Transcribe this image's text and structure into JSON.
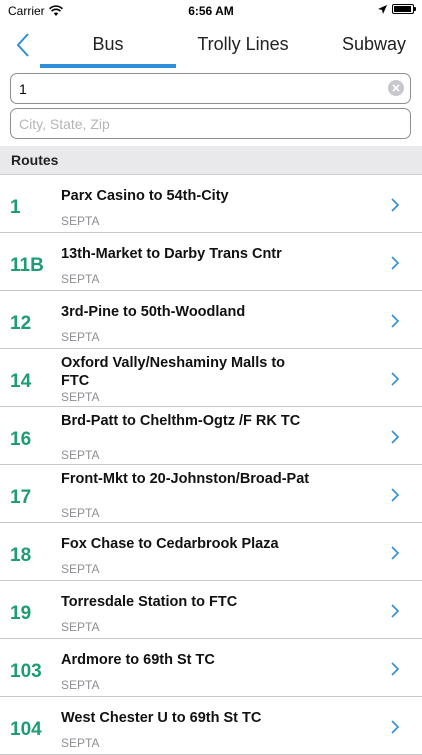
{
  "status_bar": {
    "carrier": "Carrier",
    "time": "6:56 AM",
    "battery_level": 0.95
  },
  "tabs": [
    {
      "label": "Bus",
      "selected": true
    },
    {
      "label": "Trolly Lines",
      "selected": false
    },
    {
      "label": "Subway",
      "selected": false
    }
  ],
  "search": {
    "value": "1",
    "placeholder": ""
  },
  "location": {
    "value": "",
    "placeholder": "City, State, Zip"
  },
  "section": {
    "title": "Routes"
  },
  "colors": {
    "accent": "#2f8fd8",
    "route_number": "#1e9c74"
  },
  "routes": [
    {
      "number": "1",
      "name": "Parx Casino to 54th-City",
      "agency": "SEPTA"
    },
    {
      "number": "11B",
      "name": "13th-Market to Darby Trans Cntr",
      "agency": "SEPTA"
    },
    {
      "number": "12",
      "name": "3rd-Pine to 50th-Woodland",
      "agency": "SEPTA"
    },
    {
      "number": "14",
      "name": "Oxford Vally/Neshaminy Malls to FTC",
      "agency": "SEPTA"
    },
    {
      "number": "16",
      "name": "Brd-Patt to Chelthm-Ogtz /F RK TC",
      "agency": "SEPTA"
    },
    {
      "number": "17",
      "name": "Front-Mkt to 20-Johnston/Broad-Pat",
      "agency": "SEPTA"
    },
    {
      "number": "18",
      "name": "Fox Chase to Cedarbrook Plaza",
      "agency": "SEPTA"
    },
    {
      "number": "19",
      "name": "Torresdale Station to FTC",
      "agency": "SEPTA"
    },
    {
      "number": "103",
      "name": "Ardmore to 69th St TC",
      "agency": "SEPTA"
    },
    {
      "number": "104",
      "name": "West Chester U to 69th St TC",
      "agency": "SEPTA"
    }
  ]
}
